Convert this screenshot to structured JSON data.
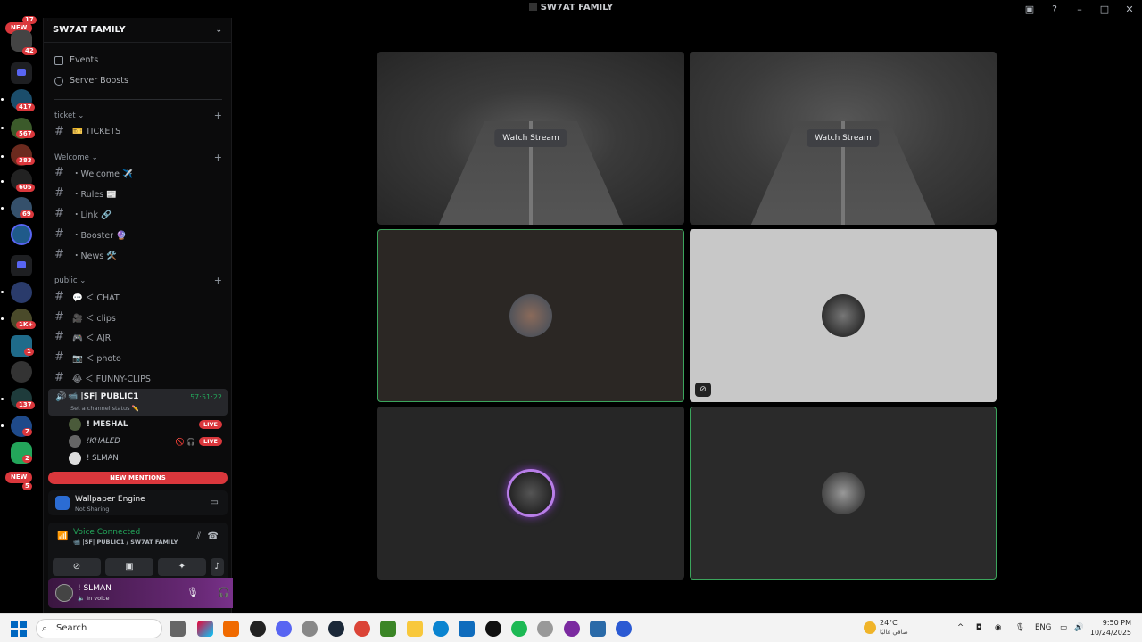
{
  "window": {
    "title": "SW7AT FAMILY"
  },
  "rail": {
    "new_top": "NEW",
    "new_bottom": "NEW",
    "badges": [
      "17",
      "42",
      "417",
      "567",
      "383",
      "605",
      "69",
      "1K+",
      "1",
      "137",
      "7",
      "2",
      "5"
    ]
  },
  "guild": {
    "name": "SW7AT FAMILY"
  },
  "menu": {
    "events": "Events",
    "boosts": "Server Boosts"
  },
  "categories": {
    "ticket": "ticket",
    "welcome": "Welcome",
    "public": "public"
  },
  "channels": {
    "tickets": "🎫 TICKETS",
    "welcome": "・Welcome ✈️",
    "rules": "・Rules 📰",
    "link": "・Link 🔗",
    "booster": "・Booster 🔮",
    "news": "・News 🛠️",
    "chat": "💬 ＜ CHAT",
    "clips": "🎥 ＜ clips",
    "ajr": "🎮 ＜ AJR",
    "photo": "📷 ＜ photo",
    "funny": "😂 ＜ FUNNY-CLIPS"
  },
  "voice_channel": {
    "name": "📹 |SF| PUBLIC1",
    "time": "57:51:22",
    "status": "Set a channel status ✏️",
    "users": [
      {
        "name": "! MESHAL",
        "live": "LIVE",
        "icons": ""
      },
      {
        "name": "!KHALED",
        "live": "LIVE",
        "icons": "🚫 🎧"
      },
      {
        "name": "! SLMAN",
        "live": "",
        "icons": ""
      }
    ]
  },
  "new_mentions": "NEW MENTIONS",
  "activity": {
    "app": "Wallpaper Engine",
    "status": "Not Sharing"
  },
  "voice": {
    "connected": "Voice Connected",
    "channel": "📹 |SF| PUBLIC1 / SW7AT FAMILY"
  },
  "user": {
    "name": "! SLMAN",
    "status": "🔈 In voice"
  },
  "tiles": [
    {
      "type": "stream",
      "watch": "Watch Stream"
    },
    {
      "type": "stream",
      "watch": "Watch Stream"
    },
    {
      "type": "avatar",
      "speaking": true
    },
    {
      "type": "avatar",
      "speaking": false,
      "muted": true
    },
    {
      "type": "avatar",
      "speaking": false
    },
    {
      "type": "avatar",
      "speaking": true
    }
  ],
  "taskbar": {
    "search": "Search",
    "temp": "24°C",
    "weather": "صافي غالبًا",
    "lang": "ENG",
    "time": "9:50 PM",
    "date": "10/24/2025"
  },
  "colors": {
    "accent_green": "#23a55a",
    "live_red": "#da373c",
    "profile_purple": "#6a2a78"
  }
}
